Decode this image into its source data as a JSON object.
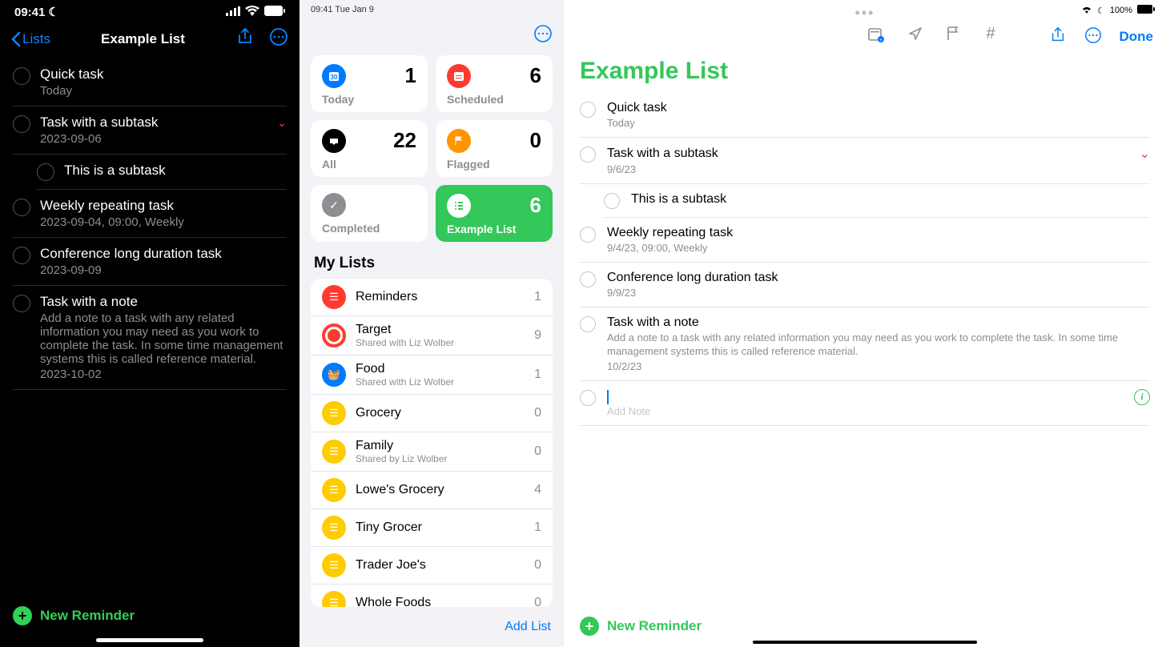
{
  "phone": {
    "status_time": "09:41",
    "back_label": "Lists",
    "title": "Example List",
    "tasks": [
      {
        "title": "Quick task",
        "sub": "Today"
      },
      {
        "title": "Task with a subtask",
        "sub": "2023-09-06",
        "expand": true
      },
      {
        "title": "This is a subtask",
        "sub": "",
        "indent": true
      },
      {
        "title": "Weekly repeating task",
        "sub": "2023-09-04, 09:00, Weekly"
      },
      {
        "title": "Conference long duration task",
        "sub": "2023-09-09"
      },
      {
        "title": "Task with a note",
        "sub": "Add a note to a task with any related information you may need as you work to complete the task. In some time management systems this is called reference material.",
        "date": "2023-10-02"
      }
    ],
    "new_reminder": "New Reminder"
  },
  "ipad_side": {
    "status": "09:41   Tue Jan 9",
    "smart": [
      {
        "label": "Today",
        "count": 1,
        "color": "#007aff"
      },
      {
        "label": "Scheduled",
        "count": 6,
        "color": "#ff3b30"
      },
      {
        "label": "All",
        "count": 22,
        "color": "#000"
      },
      {
        "label": "Flagged",
        "count": 0,
        "color": "#ff9500"
      },
      {
        "label": "Completed",
        "count": "",
        "color": "#8e8e93"
      },
      {
        "label": "Example List",
        "count": 6,
        "color": "#34c759",
        "selected": true
      }
    ],
    "my_lists_h": "My Lists",
    "lists": [
      {
        "name": "Reminders",
        "count": 1,
        "color": "#ff3b30"
      },
      {
        "name": "Target",
        "shared": "Shared with Liz Wolber",
        "count": 9,
        "target": true
      },
      {
        "name": "Food",
        "shared": "Shared with Liz Wolber",
        "count": 1,
        "color": "#007aff"
      },
      {
        "name": "Grocery",
        "count": 0,
        "color": "#ffcc00"
      },
      {
        "name": "Family",
        "shared": "Shared by Liz Wolber",
        "count": 0,
        "color": "#ffcc00"
      },
      {
        "name": "Lowe's Grocery",
        "count": 4,
        "color": "#ffcc00"
      },
      {
        "name": "Tiny Grocer",
        "count": 1,
        "color": "#ffcc00"
      },
      {
        "name": "Trader Joe's",
        "count": 0,
        "color": "#ffcc00"
      },
      {
        "name": "Whole Foods",
        "count": 0,
        "color": "#ffcc00"
      }
    ],
    "add_list": "Add List"
  },
  "ipad_main": {
    "battery": "100%",
    "done": "Done",
    "title": "Example List",
    "tasks": [
      {
        "title": "Quick task",
        "sub": "Today"
      },
      {
        "title": "Task with a subtask",
        "sub": "9/6/23",
        "expand": true
      },
      {
        "title": "This is a subtask",
        "indent": true
      },
      {
        "title": "Weekly repeating task",
        "sub": "9/4/23, 09:00, Weekly"
      },
      {
        "title": "Conference long duration task",
        "sub": "9/9/23"
      },
      {
        "title": "Task with a note",
        "note": "Add a note to a task with any related information you may need as you work to complete the task. In some time management systems this is called reference material.",
        "sub": "10/2/23"
      }
    ],
    "add_note_placeholder": "Add Note",
    "new_reminder": "New Reminder"
  }
}
